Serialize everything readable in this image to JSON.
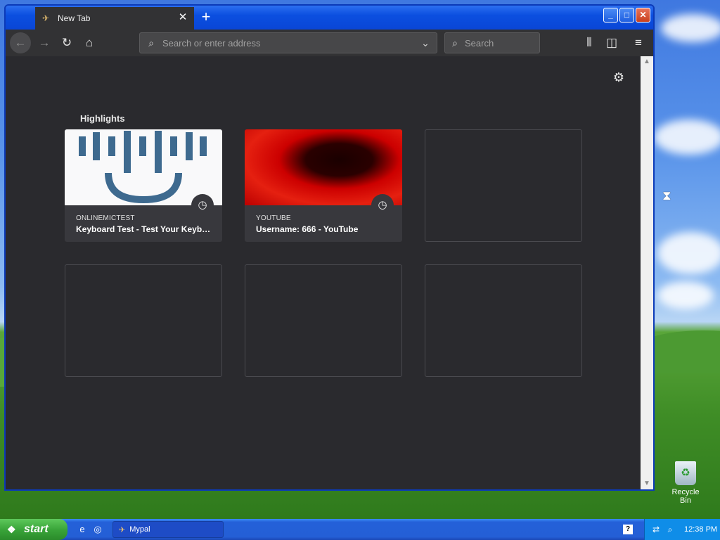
{
  "browser": {
    "tab": {
      "title": "New Tab",
      "close": "✕"
    },
    "new_tab": "+",
    "window_controls": {
      "minimize": "_",
      "maximize": "□",
      "close": "✕"
    },
    "nav": {
      "back_icon": "arrow-left",
      "forward_icon": "arrow-right",
      "reload_icon": "reload",
      "home_icon": "home",
      "address_placeholder": "Search or enter address",
      "search_placeholder": "Search",
      "library_icon": "library",
      "sidebar_icon": "sidebar",
      "menu_icon": "hamburger"
    }
  },
  "newtab": {
    "section_title": "Highlights",
    "highlights": [
      {
        "site": "ONLINEMICTEST",
        "title": "Keyboard Test - Test Your Keyboard Online",
        "thumb": "mic"
      },
      {
        "site": "YOUTUBE",
        "title": "Username: 666 - YouTube",
        "thumb": "yt"
      }
    ]
  },
  "desktop": {
    "recycle_bin_label": "Recycle Bin"
  },
  "taskbar": {
    "start_label": "start",
    "task_label": "Mypal",
    "help": "?",
    "clock": "12:38 PM"
  },
  "colors": {
    "browser_chrome": "#323234",
    "page_background": "#2a2a2e",
    "card_background": "#38383d"
  }
}
